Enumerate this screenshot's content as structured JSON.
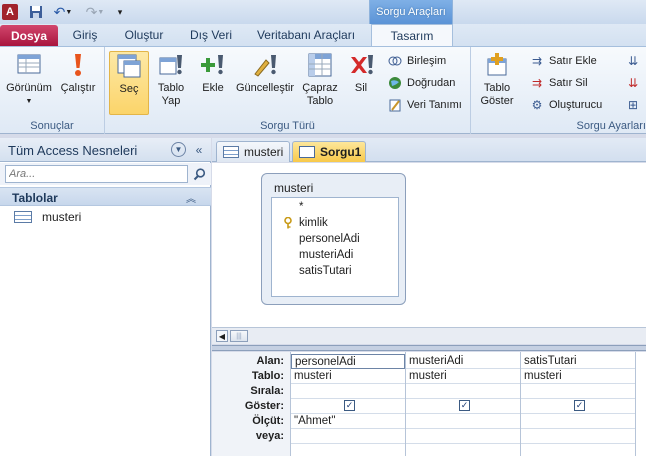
{
  "titlebar": {
    "app_icon": "A",
    "context_tab_group": "Sorgu Araçları"
  },
  "tabs": {
    "dosya": "Dosya",
    "giris": "Giriş",
    "olustur": "Oluştur",
    "dis_veri": "Dış Veri",
    "veritabani": "Veritabanı Araçları",
    "tasarim": "Tasarım"
  },
  "ribbon": {
    "sonuclar": {
      "label": "Sonuçlar",
      "gorunum": "Görünüm",
      "calistir": "Çalıştır"
    },
    "sorgu_turu": {
      "label": "Sorgu Türü",
      "sec": "Seç",
      "tablo_yap_1": "Tablo",
      "tablo_yap_2": "Yap",
      "ekle": "Ekle",
      "guncellestir": "Güncelleştir",
      "capraz_1": "Çapraz",
      "capraz_2": "Tablo",
      "sil": "Sil",
      "birlesim": "Birleşim",
      "dogrudan": "Doğrudan",
      "veri_tanimi": "Veri Tanımı"
    },
    "sorgu_ayarlari": {
      "label": "Sorgu Ayarları",
      "tablo_goster_1": "Tablo",
      "tablo_goster_2": "Göster",
      "satir_ekle": "Satır Ekle",
      "satir_sil": "Satır Sil",
      "olusturucu": "Oluşturucu"
    }
  },
  "nav": {
    "title": "Tüm Access Nesneleri",
    "search_placeholder": "Ara...",
    "section": "Tablolar",
    "items": [
      {
        "label": "musteri"
      }
    ]
  },
  "doc_tabs": [
    {
      "label": "musteri"
    },
    {
      "label": "Sorgu1"
    }
  ],
  "field_list": {
    "title": "musteri",
    "fields": [
      "*",
      "kimlik",
      "personelAdi",
      "musteriAdi",
      "satisTutari"
    ]
  },
  "qbe": {
    "row_labels": [
      "Alan:",
      "Tablo:",
      "Sırala:",
      "Göster:",
      "Ölçüt:",
      "veya:"
    ],
    "columns": [
      {
        "alan": "personelAdi",
        "tablo": "musteri",
        "sirala": "",
        "goster": true,
        "olcut": "\"Ahmet\"",
        "veya": ""
      },
      {
        "alan": "musteriAdi",
        "tablo": "musteri",
        "sirala": "",
        "goster": true,
        "olcut": "",
        "veya": ""
      },
      {
        "alan": "satisTutari",
        "tablo": "musteri",
        "sirala": "",
        "goster": true,
        "olcut": "",
        "veya": ""
      }
    ]
  },
  "colors": {
    "dosya_tab": "#b61a44",
    "accent": "#5b93d6",
    "active_doc_tab": "#f8c94a"
  }
}
